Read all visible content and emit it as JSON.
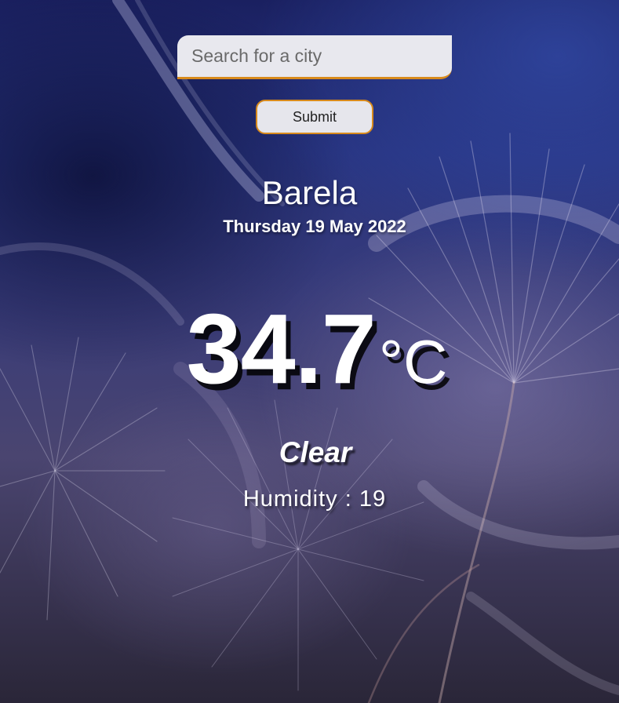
{
  "search": {
    "placeholder": "Search for a city",
    "value": ""
  },
  "submit_label": "Submit",
  "weather": {
    "city": "Barela",
    "date": "Thursday 19 May 2022",
    "temperature": "34.7",
    "unit": "°C",
    "condition": "Clear",
    "humidity_label": "Humidity",
    "humidity_separator": ":",
    "humidity_value": "19"
  },
  "colors": {
    "accent": "#d88a1c",
    "input_background": "#e8e8ee",
    "text": "#ffffff"
  }
}
